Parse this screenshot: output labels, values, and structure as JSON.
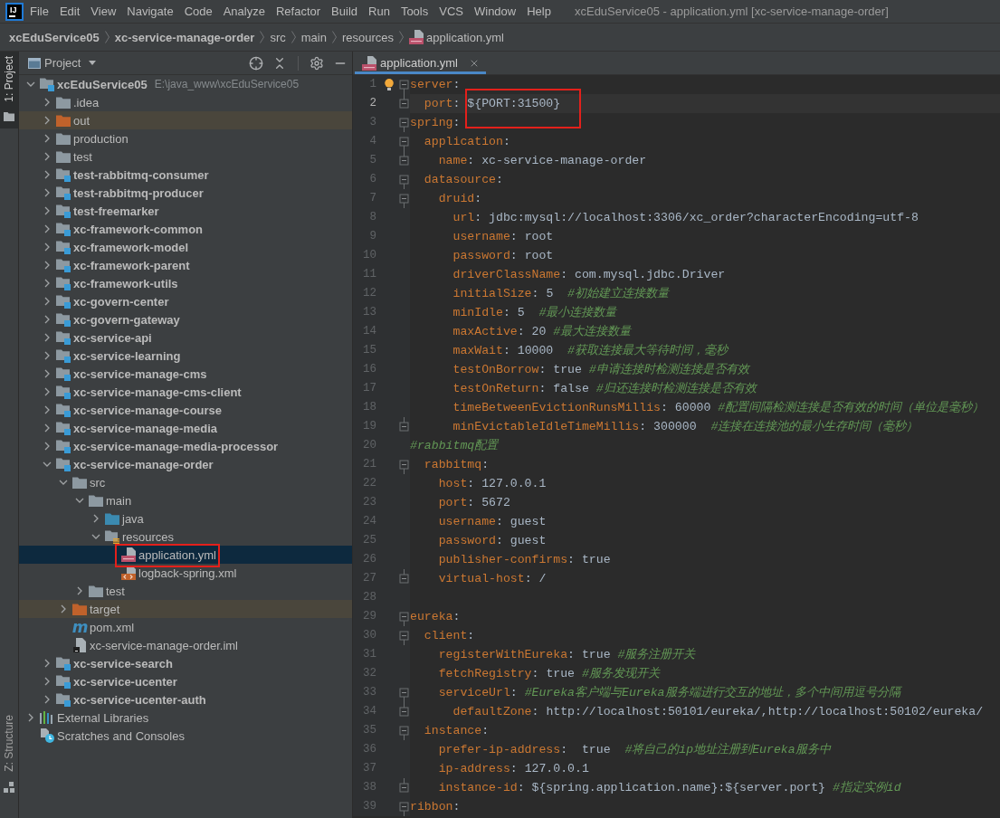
{
  "window": {
    "logo": "IJ",
    "title": "xcEduService05 - application.yml [xc-service-manage-order]"
  },
  "menu": [
    "File",
    "Edit",
    "View",
    "Navigate",
    "Code",
    "Analyze",
    "Refactor",
    "Build",
    "Run",
    "Tools",
    "VCS",
    "Window",
    "Help"
  ],
  "breadcrumbs": [
    {
      "label": "xcEduService05",
      "kind": "project"
    },
    {
      "label": "xc-service-manage-order",
      "kind": "module"
    },
    {
      "label": "src",
      "kind": "folder"
    },
    {
      "label": "main",
      "kind": "folder"
    },
    {
      "label": "resources",
      "kind": "folder"
    },
    {
      "label": "application.yml",
      "kind": "yml"
    }
  ],
  "tool_stripe": [
    {
      "label": "1: Project",
      "kind": "project",
      "selected": true
    },
    {
      "label": "Z: Structure",
      "kind": "structure",
      "selected": false
    }
  ],
  "project_panel": {
    "title": "Project",
    "tree": [
      {
        "label": "xcEduService05",
        "path": "E:\\java_www\\xcEduService05",
        "kind": "module",
        "expanded": true,
        "selected": false,
        "annotated": false,
        "children": [
          {
            "label": ".idea",
            "kind": "folder",
            "expanded": false,
            "selected": false,
            "annotated": false
          },
          {
            "label": "out",
            "kind": "excluded",
            "expanded": false,
            "selected": false,
            "annotated": false
          },
          {
            "label": "production",
            "kind": "folder",
            "expanded": false,
            "selected": false,
            "annotated": false
          },
          {
            "label": "test",
            "kind": "folder",
            "expanded": false,
            "selected": false,
            "annotated": false
          },
          {
            "label": "test-rabbitmq-consumer",
            "kind": "module",
            "expanded": false,
            "selected": false,
            "annotated": false
          },
          {
            "label": "test-rabbitmq-producer",
            "kind": "module",
            "expanded": false,
            "selected": false,
            "annotated": false
          },
          {
            "label": "test-freemarker",
            "kind": "module",
            "expanded": false,
            "selected": false,
            "annotated": false
          },
          {
            "label": "xc-framework-common",
            "kind": "module",
            "expanded": false,
            "selected": false,
            "annotated": false
          },
          {
            "label": "xc-framework-model",
            "kind": "module",
            "expanded": false,
            "selected": false,
            "annotated": false
          },
          {
            "label": "xc-framework-parent",
            "kind": "module",
            "expanded": false,
            "selected": false,
            "annotated": false
          },
          {
            "label": "xc-framework-utils",
            "kind": "module",
            "expanded": false,
            "selected": false,
            "annotated": false
          },
          {
            "label": "xc-govern-center",
            "kind": "module",
            "expanded": false,
            "selected": false,
            "annotated": false
          },
          {
            "label": "xc-govern-gateway",
            "kind": "module",
            "expanded": false,
            "selected": false,
            "annotated": false
          },
          {
            "label": "xc-service-api",
            "kind": "module",
            "expanded": false,
            "selected": false,
            "annotated": false
          },
          {
            "label": "xc-service-learning",
            "kind": "module",
            "expanded": false,
            "selected": false,
            "annotated": false
          },
          {
            "label": "xc-service-manage-cms",
            "kind": "module",
            "expanded": false,
            "selected": false,
            "annotated": false
          },
          {
            "label": "xc-service-manage-cms-client",
            "kind": "module",
            "expanded": false,
            "selected": false,
            "annotated": false
          },
          {
            "label": "xc-service-manage-course",
            "kind": "module",
            "expanded": false,
            "selected": false,
            "annotated": false
          },
          {
            "label": "xc-service-manage-media",
            "kind": "module",
            "expanded": false,
            "selected": false,
            "annotated": false
          },
          {
            "label": "xc-service-manage-media-processor",
            "kind": "module",
            "expanded": false,
            "selected": false,
            "annotated": false
          },
          {
            "label": "xc-service-manage-order",
            "kind": "module",
            "expanded": true,
            "selected": false,
            "annotated": false,
            "children": [
              {
                "label": "src",
                "kind": "folder",
                "expanded": true,
                "selected": false,
                "annotated": false,
                "children": [
                  {
                    "label": "main",
                    "kind": "folder",
                    "expanded": true,
                    "selected": false,
                    "annotated": false,
                    "children": [
                      {
                        "label": "java",
                        "kind": "source",
                        "expanded": false,
                        "selected": false,
                        "annotated": false
                      },
                      {
                        "label": "resources",
                        "kind": "resources",
                        "expanded": true,
                        "selected": false,
                        "annotated": false,
                        "children": [
                          {
                            "label": "application.yml",
                            "kind": "yml",
                            "selected": true,
                            "annotated": true
                          },
                          {
                            "label": "logback-spring.xml",
                            "kind": "xml",
                            "selected": false,
                            "annotated": false
                          }
                        ]
                      }
                    ]
                  },
                  {
                    "label": "test",
                    "kind": "folder",
                    "expanded": false,
                    "selected": false,
                    "annotated": false
                  }
                ]
              },
              {
                "label": "target",
                "kind": "excluded",
                "expanded": false,
                "selected": false,
                "annotated": false
              },
              {
                "label": "pom.xml",
                "kind": "maven",
                "glyph": "m",
                "selected": false,
                "annotated": false
              },
              {
                "label": "xc-service-manage-order.iml",
                "kind": "iml",
                "selected": false,
                "annotated": false
              }
            ]
          },
          {
            "label": "xc-service-search",
            "kind": "module",
            "expanded": false,
            "selected": false,
            "annotated": false
          },
          {
            "label": "xc-service-ucenter",
            "kind": "module",
            "expanded": false,
            "selected": false,
            "annotated": false
          },
          {
            "label": "xc-service-ucenter-auth",
            "kind": "module",
            "expanded": false,
            "selected": false,
            "annotated": false
          }
        ]
      },
      {
        "label": "External Libraries",
        "kind": "libraries",
        "expanded": false,
        "selected": false,
        "annotated": false
      },
      {
        "label": "Scratches and Consoles",
        "kind": "scratches",
        "selected": false,
        "annotated": false
      }
    ]
  },
  "editor": {
    "tabs": [
      {
        "label": "application.yml",
        "selected": true
      }
    ],
    "lines": [
      {
        "number": "1",
        "kind": "opener",
        "current": false,
        "annotated": false,
        "bulb": true,
        "tokens": [
          {
            "kind": "key",
            "text": "server"
          },
          {
            "kind": "sign",
            "text": ":"
          }
        ]
      },
      {
        "number": "2",
        "kind": "closer",
        "current": true,
        "annotated": true,
        "bulb": false,
        "tokens": [
          {
            "kind": "key",
            "text": "  port"
          },
          {
            "kind": "sign",
            "text": ": "
          },
          {
            "kind": "value",
            "text": "${PORT:31500}"
          }
        ]
      },
      {
        "number": "3",
        "kind": "opener",
        "current": false,
        "annotated": false,
        "bulb": false,
        "tokens": [
          {
            "kind": "key",
            "text": "spring"
          },
          {
            "kind": "sign",
            "text": ":"
          }
        ]
      },
      {
        "number": "4",
        "kind": "opener",
        "current": false,
        "annotated": false,
        "bulb": false,
        "tokens": [
          {
            "kind": "key",
            "text": "  application"
          },
          {
            "kind": "sign",
            "text": ":"
          }
        ]
      },
      {
        "number": "5",
        "kind": "closer",
        "current": false,
        "annotated": false,
        "bulb": false,
        "tokens": [
          {
            "kind": "key",
            "text": "    name"
          },
          {
            "kind": "sign",
            "text": ": "
          },
          {
            "kind": "value",
            "text": "xc-service-manage-order"
          }
        ]
      },
      {
        "number": "6",
        "kind": "opener",
        "current": false,
        "annotated": false,
        "bulb": false,
        "tokens": [
          {
            "kind": "key",
            "text": "  datasource"
          },
          {
            "kind": "sign",
            "text": ":"
          }
        ]
      },
      {
        "number": "7",
        "kind": "opener",
        "current": false,
        "annotated": false,
        "bulb": false,
        "tokens": [
          {
            "kind": "key",
            "text": "    druid"
          },
          {
            "kind": "sign",
            "text": ":"
          }
        ]
      },
      {
        "number": "8",
        "kind": "plain",
        "current": false,
        "annotated": false,
        "bulb": false,
        "tokens": [
          {
            "kind": "key",
            "text": "      url"
          },
          {
            "kind": "sign",
            "text": ": "
          },
          {
            "kind": "value",
            "text": "jdbc:mysql://localhost:3306/xc_order?characterEncoding=utf-8"
          }
        ]
      },
      {
        "number": "9",
        "kind": "plain",
        "current": false,
        "annotated": false,
        "bulb": false,
        "tokens": [
          {
            "kind": "key",
            "text": "      username"
          },
          {
            "kind": "sign",
            "text": ": "
          },
          {
            "kind": "value",
            "text": "root"
          }
        ]
      },
      {
        "number": "10",
        "kind": "plain",
        "current": false,
        "annotated": false,
        "bulb": false,
        "tokens": [
          {
            "kind": "key",
            "text": "      password"
          },
          {
            "kind": "sign",
            "text": ": "
          },
          {
            "kind": "value",
            "text": "root"
          }
        ]
      },
      {
        "number": "11",
        "kind": "plain",
        "current": false,
        "annotated": false,
        "bulb": false,
        "tokens": [
          {
            "kind": "key",
            "text": "      driverClassName"
          },
          {
            "kind": "sign",
            "text": ": "
          },
          {
            "kind": "value",
            "text": "com.mysql.jdbc.Driver"
          }
        ]
      },
      {
        "number": "12",
        "kind": "plain",
        "current": false,
        "annotated": false,
        "bulb": false,
        "tokens": [
          {
            "kind": "key",
            "text": "      initialSize"
          },
          {
            "kind": "sign",
            "text": ": "
          },
          {
            "kind": "value",
            "text": "5"
          },
          {
            "kind": "comment",
            "text": "  #初始建立连接数量"
          }
        ]
      },
      {
        "number": "13",
        "kind": "plain",
        "current": false,
        "annotated": false,
        "bulb": false,
        "tokens": [
          {
            "kind": "key",
            "text": "      minIdle"
          },
          {
            "kind": "sign",
            "text": ": "
          },
          {
            "kind": "value",
            "text": "5"
          },
          {
            "kind": "comment",
            "text": "  #最小连接数量"
          }
        ]
      },
      {
        "number": "14",
        "kind": "plain",
        "current": false,
        "annotated": false,
        "bulb": false,
        "tokens": [
          {
            "kind": "key",
            "text": "      maxActive"
          },
          {
            "kind": "sign",
            "text": ": "
          },
          {
            "kind": "value",
            "text": "20"
          },
          {
            "kind": "comment",
            "text": " #最大连接数量"
          }
        ]
      },
      {
        "number": "15",
        "kind": "plain",
        "current": false,
        "annotated": false,
        "bulb": false,
        "tokens": [
          {
            "kind": "key",
            "text": "      maxWait"
          },
          {
            "kind": "sign",
            "text": ": "
          },
          {
            "kind": "value",
            "text": "10000"
          },
          {
            "kind": "comment",
            "text": "  #获取连接最大等待时间，毫秒"
          }
        ]
      },
      {
        "number": "16",
        "kind": "plain",
        "current": false,
        "annotated": false,
        "bulb": false,
        "tokens": [
          {
            "kind": "key",
            "text": "      testOnBorrow"
          },
          {
            "kind": "sign",
            "text": ": "
          },
          {
            "kind": "value",
            "text": "true"
          },
          {
            "kind": "comment",
            "text": " #申请连接时检测连接是否有效"
          }
        ]
      },
      {
        "number": "17",
        "kind": "plain",
        "current": false,
        "annotated": false,
        "bulb": false,
        "tokens": [
          {
            "kind": "key",
            "text": "      testOnReturn"
          },
          {
            "kind": "sign",
            "text": ": "
          },
          {
            "kind": "value",
            "text": "false"
          },
          {
            "kind": "comment",
            "text": " #归还连接时检测连接是否有效"
          }
        ]
      },
      {
        "number": "18",
        "kind": "plain",
        "current": false,
        "annotated": false,
        "bulb": false,
        "tokens": [
          {
            "kind": "key",
            "text": "      timeBetweenEvictionRunsMillis"
          },
          {
            "kind": "sign",
            "text": ": "
          },
          {
            "kind": "value",
            "text": "60000"
          },
          {
            "kind": "comment",
            "text": " #配置间隔检测连接是否有效的时间（单位是毫秒）"
          }
        ]
      },
      {
        "number": "19",
        "kind": "closer",
        "current": false,
        "annotated": false,
        "bulb": false,
        "tokens": [
          {
            "kind": "key",
            "text": "      minEvictableIdleTimeMillis"
          },
          {
            "kind": "sign",
            "text": ": "
          },
          {
            "kind": "value",
            "text": "300000"
          },
          {
            "kind": "comment",
            "text": "  #连接在连接池的最小生存时间（毫秒）"
          }
        ]
      },
      {
        "number": "20",
        "kind": "plain",
        "current": false,
        "annotated": false,
        "bulb": false,
        "tokens": [
          {
            "kind": "comment",
            "text": "#rabbitmq配置"
          }
        ]
      },
      {
        "number": "21",
        "kind": "opener",
        "current": false,
        "annotated": false,
        "bulb": false,
        "tokens": [
          {
            "kind": "key",
            "text": "  rabbitmq"
          },
          {
            "kind": "sign",
            "text": ":"
          }
        ]
      },
      {
        "number": "22",
        "kind": "plain",
        "current": false,
        "annotated": false,
        "bulb": false,
        "tokens": [
          {
            "kind": "key",
            "text": "    host"
          },
          {
            "kind": "sign",
            "text": ": "
          },
          {
            "kind": "value",
            "text": "127.0.0.1"
          }
        ]
      },
      {
        "number": "23",
        "kind": "plain",
        "current": false,
        "annotated": false,
        "bulb": false,
        "tokens": [
          {
            "kind": "key",
            "text": "    port"
          },
          {
            "kind": "sign",
            "text": ": "
          },
          {
            "kind": "value",
            "text": "5672"
          }
        ]
      },
      {
        "number": "24",
        "kind": "plain",
        "current": false,
        "annotated": false,
        "bulb": false,
        "tokens": [
          {
            "kind": "key",
            "text": "    username"
          },
          {
            "kind": "sign",
            "text": ": "
          },
          {
            "kind": "value",
            "text": "guest"
          }
        ]
      },
      {
        "number": "25",
        "kind": "plain",
        "current": false,
        "annotated": false,
        "bulb": false,
        "tokens": [
          {
            "kind": "key",
            "text": "    password"
          },
          {
            "kind": "sign",
            "text": ": "
          },
          {
            "kind": "value",
            "text": "guest"
          }
        ]
      },
      {
        "number": "26",
        "kind": "plain",
        "current": false,
        "annotated": false,
        "bulb": false,
        "tokens": [
          {
            "kind": "key",
            "text": "    publisher-confirms"
          },
          {
            "kind": "sign",
            "text": ": "
          },
          {
            "kind": "value",
            "text": "true"
          }
        ]
      },
      {
        "number": "27",
        "kind": "closer",
        "current": false,
        "annotated": false,
        "bulb": false,
        "tokens": [
          {
            "kind": "key",
            "text": "    virtual-host"
          },
          {
            "kind": "sign",
            "text": ": "
          },
          {
            "kind": "value",
            "text": "/"
          }
        ]
      },
      {
        "number": "28",
        "kind": "plain",
        "current": false,
        "annotated": false,
        "bulb": false
      },
      {
        "number": "29",
        "kind": "opener",
        "current": false,
        "annotated": false,
        "bulb": false,
        "tokens": [
          {
            "kind": "key",
            "text": "eureka"
          },
          {
            "kind": "sign",
            "text": ":"
          }
        ]
      },
      {
        "number": "30",
        "kind": "opener",
        "current": false,
        "annotated": false,
        "bulb": false,
        "tokens": [
          {
            "kind": "key",
            "text": "  client"
          },
          {
            "kind": "sign",
            "text": ":"
          }
        ]
      },
      {
        "number": "31",
        "kind": "plain",
        "current": false,
        "annotated": false,
        "bulb": false,
        "tokens": [
          {
            "kind": "key",
            "text": "    registerWithEureka"
          },
          {
            "kind": "sign",
            "text": ": "
          },
          {
            "kind": "value",
            "text": "true"
          },
          {
            "kind": "comment",
            "text": " #服务注册开关"
          }
        ]
      },
      {
        "number": "32",
        "kind": "plain",
        "current": false,
        "annotated": false,
        "bulb": false,
        "tokens": [
          {
            "kind": "key",
            "text": "    fetchRegistry"
          },
          {
            "kind": "sign",
            "text": ": "
          },
          {
            "kind": "value",
            "text": "true"
          },
          {
            "kind": "comment",
            "text": " #服务发现开关"
          }
        ]
      },
      {
        "number": "33",
        "kind": "opener",
        "current": false,
        "annotated": false,
        "bulb": false,
        "tokens": [
          {
            "kind": "key",
            "text": "    serviceUrl"
          },
          {
            "kind": "sign",
            "text": ":"
          },
          {
            "kind": "comment",
            "text": " #Eureka客户端与Eureka服务端进行交互的地址，多个中间用逗号分隔"
          }
        ]
      },
      {
        "number": "34",
        "kind": "closer",
        "current": false,
        "annotated": false,
        "bulb": false,
        "tokens": [
          {
            "kind": "key",
            "text": "      defaultZone"
          },
          {
            "kind": "sign",
            "text": ": "
          },
          {
            "kind": "value",
            "text": "http://localhost:50101/eureka/,http://localhost:50102/eureka/"
          }
        ]
      },
      {
        "number": "35",
        "kind": "opener",
        "current": false,
        "annotated": false,
        "bulb": false,
        "tokens": [
          {
            "kind": "key",
            "text": "  instance"
          },
          {
            "kind": "sign",
            "text": ":"
          }
        ]
      },
      {
        "number": "36",
        "kind": "plain",
        "current": false,
        "annotated": false,
        "bulb": false,
        "tokens": [
          {
            "kind": "key",
            "text": "    prefer-ip-address"
          },
          {
            "kind": "sign",
            "text": ":  "
          },
          {
            "kind": "value",
            "text": "true"
          },
          {
            "kind": "comment",
            "text": "  #将自己的ip地址注册到Eureka服务中"
          }
        ]
      },
      {
        "number": "37",
        "kind": "plain",
        "current": false,
        "annotated": false,
        "bulb": false,
        "tokens": [
          {
            "kind": "key",
            "text": "    ip-address"
          },
          {
            "kind": "sign",
            "text": ": "
          },
          {
            "kind": "value",
            "text": "127.0.0.1"
          }
        ]
      },
      {
        "number": "38",
        "kind": "closer",
        "current": false,
        "annotated": false,
        "bulb": false,
        "tokens": [
          {
            "kind": "key",
            "text": "    instance-id"
          },
          {
            "kind": "sign",
            "text": ": "
          },
          {
            "kind": "value",
            "text": "${spring.application.name}:${server.port}"
          },
          {
            "kind": "comment",
            "text": " #指定实例id"
          }
        ]
      },
      {
        "number": "39",
        "kind": "opener",
        "current": false,
        "annotated": false,
        "bulb": false,
        "tokens": [
          {
            "kind": "key",
            "text": "ribbon"
          },
          {
            "kind": "sign",
            "text": ":"
          }
        ]
      }
    ]
  }
}
